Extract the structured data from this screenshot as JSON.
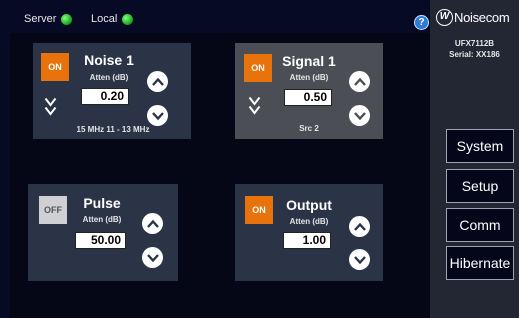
{
  "status": {
    "server_label": "Server",
    "local_label": "Local",
    "help_symbol": "?"
  },
  "brand": {
    "logo_symbol": "W",
    "name": "Noisecom",
    "model": "UFX7112B",
    "serial": "Serial: XX186"
  },
  "panels": {
    "noise1": {
      "state": "ON",
      "title": "Noise 1",
      "atten_label": "Atten (dB)",
      "value": "0.20",
      "note": "15 MHz  11 - 13 MHz"
    },
    "signal1": {
      "state": "ON",
      "title": "Signal 1",
      "atten_label": "Atten (dB)",
      "value": "0.50",
      "note": "Src 2"
    },
    "pulse": {
      "state": "OFF",
      "title": "Pulse",
      "atten_label": "Atten (dB)",
      "value": "50.00"
    },
    "output": {
      "state": "ON",
      "title": "Output",
      "atten_label": "Atten (dB)",
      "value": "1.00"
    }
  },
  "nav": {
    "system": "System",
    "setup": "Setup",
    "comm": "Comm",
    "hibernate": "Hibernate"
  },
  "colors": {
    "background": "#070a24",
    "panel": "#2b3346",
    "panel_selected": "#4c4e55",
    "on_button": "#e8720c",
    "off_button": "#cfd0d4",
    "status_led": "#17a017",
    "help_icon": "#2e7bd6"
  }
}
